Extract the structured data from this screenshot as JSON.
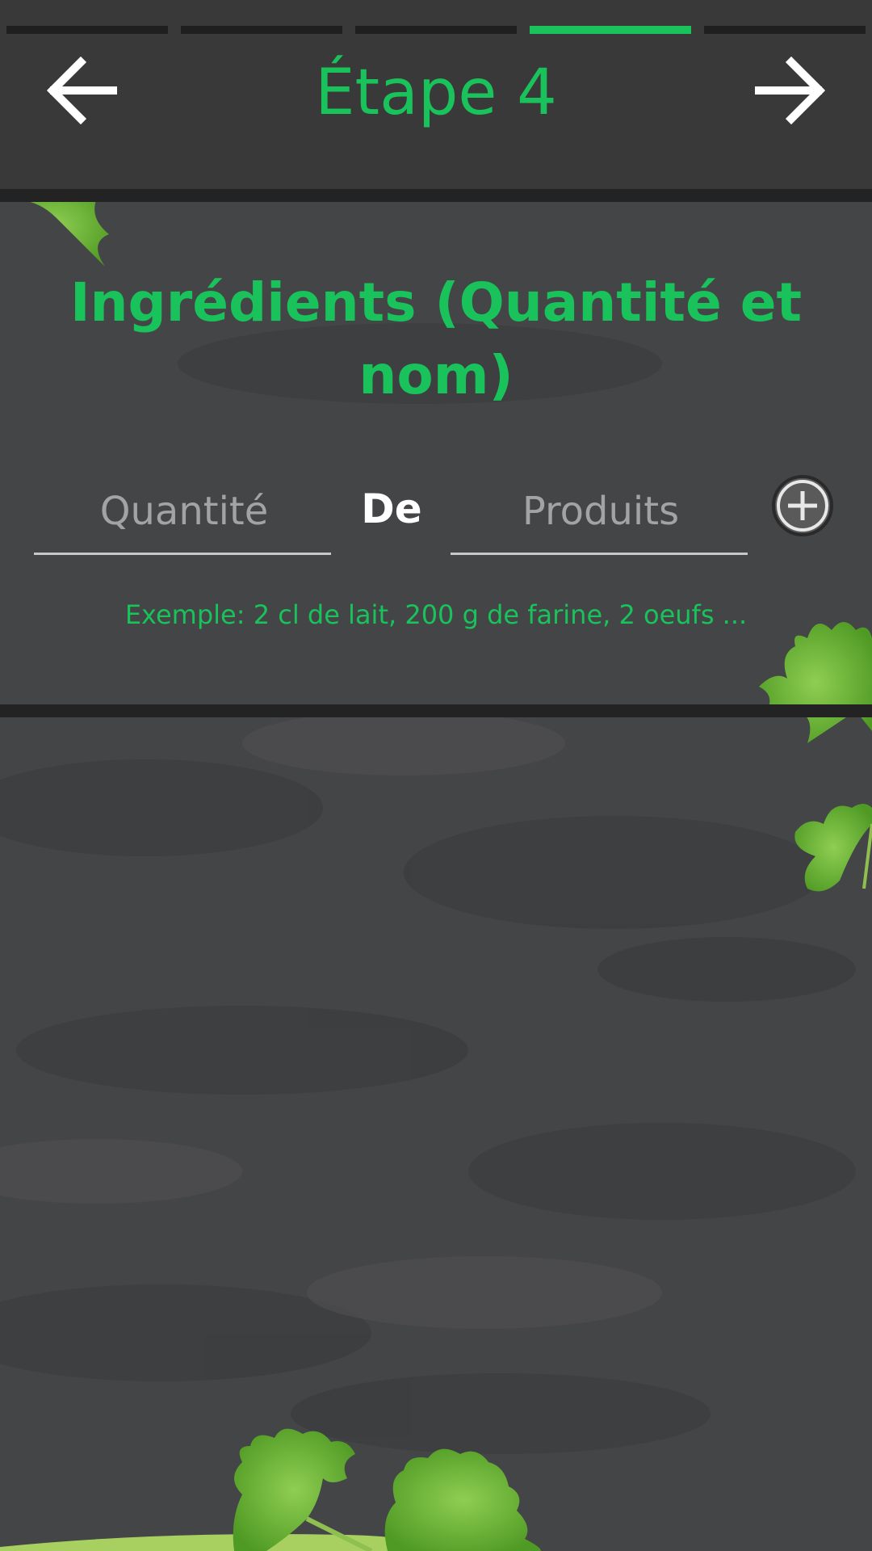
{
  "header": {
    "step_title": "Étape 4",
    "progress_total_steps": 5,
    "progress_current_step": 4,
    "back_icon": "arrow-left-icon",
    "next_icon": "arrow-right-icon"
  },
  "ingredients": {
    "title": "Ingrédients (Quantité et nom)",
    "quantity_placeholder": "Quantité",
    "quantity_value": "",
    "connector": "De",
    "product_placeholder": "Produits",
    "product_value": "",
    "add_icon": "plus-circle-icon",
    "hint": "Exemple: 2 cl de lait, 200 g de farine, 2 oeufs ..."
  },
  "colors": {
    "accent": "#19c25a",
    "header_bg": "#393939",
    "progress_inactive": "#1f1f1f",
    "background": "#444546"
  },
  "background_decoration": "parsley-leaves"
}
